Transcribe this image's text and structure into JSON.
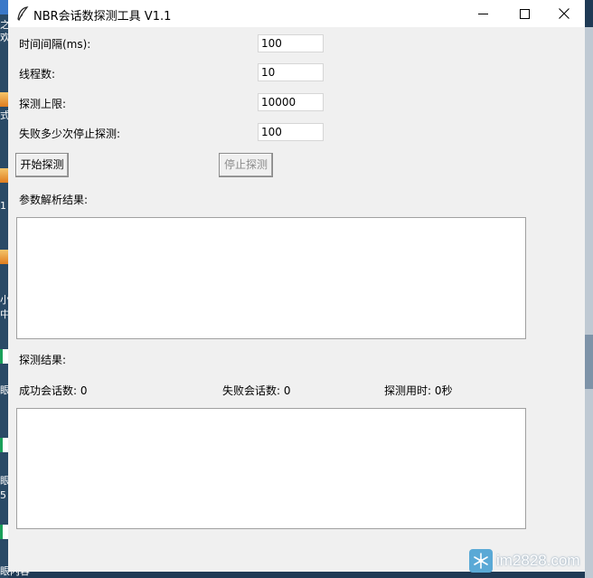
{
  "window": {
    "title": "NBR会话数探测工具 V1.1"
  },
  "form": {
    "interval_label": "时间间隔(ms):",
    "interval_value": "100",
    "threads_label": "线程数:",
    "threads_value": "10",
    "upper_limit_label": "探测上限:",
    "upper_limit_value": "10000",
    "fail_stop_label": "失败多少次停止探测:",
    "fail_stop_value": "100"
  },
  "buttons": {
    "start_label": "开始探测",
    "stop_label": "停止探测",
    "stop_enabled": false
  },
  "params": {
    "label": "参数解析结果:",
    "content": ""
  },
  "results": {
    "label": "探测结果:",
    "success_text": "成功会话数: 0",
    "fail_text": "失败会话数: 0",
    "time_text": "探测用时: 0秒",
    "content": ""
  },
  "desktop": {
    "left_chars": [
      "之",
      "欢",
      "式",
      "1",
      "小",
      "中",
      "眼",
      "眼",
      "5",
      "眼内容"
    ],
    "watermark_text": "im2828.com"
  },
  "colors": {
    "window_bg": "#f0f0f0",
    "titlebar_bg": "#ffffff",
    "desktop_bg": "#1f3a55"
  },
  "icons": {
    "app": "feather-icon",
    "minimize": "minimize-icon",
    "maximize": "maximize-icon",
    "close": "close-icon",
    "watermark": "snowflake-icon"
  }
}
